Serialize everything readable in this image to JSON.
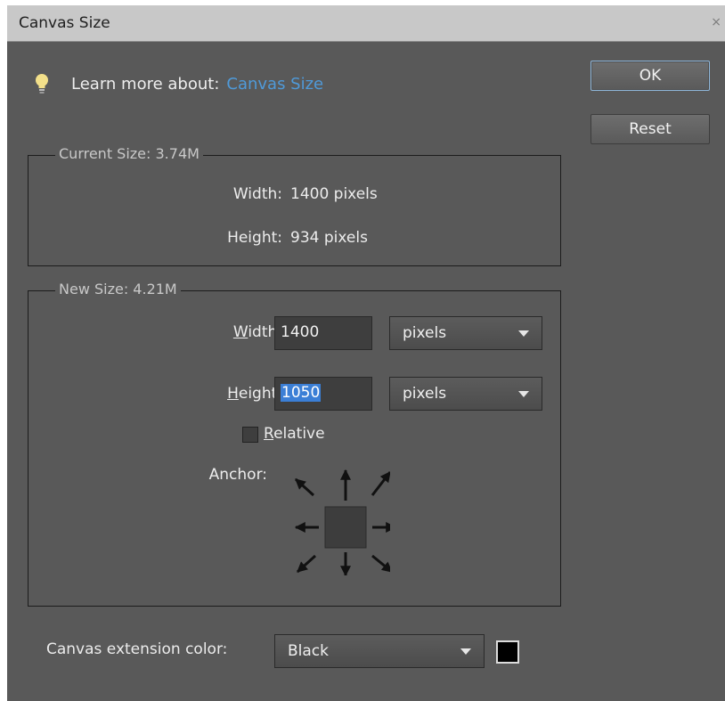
{
  "window": {
    "title": "Canvas Size",
    "close_glyph": "×"
  },
  "learn_more": {
    "prefix": "Learn more about:",
    "link": "Canvas Size",
    "icon": "lightbulb-icon"
  },
  "buttons": {
    "ok": "OK",
    "reset": "Reset"
  },
  "current_size": {
    "legend": "Current Size: 3.74M",
    "width_label": "Width:",
    "width_value": "1400 pixels",
    "height_label": "Height:",
    "height_value": "934 pixels"
  },
  "new_size": {
    "legend": "New Size: 4.21M",
    "width_label_u": "W",
    "width_label_rest": "idth:",
    "width_value": "1400",
    "width_unit": "pixels",
    "height_label_u": "H",
    "height_label_rest": "eight:",
    "height_value": "1050",
    "height_unit": "pixels",
    "relative_u": "R",
    "relative_rest": "elative",
    "relative_checked": false,
    "anchor_label": "Anchor:"
  },
  "extension": {
    "label": "Canvas extension color:",
    "value": "Black",
    "swatch_color": "#000000"
  },
  "colors": {
    "link": "#4f9ad9",
    "selection": "#3b7fd6",
    "dialog_bg": "#595959"
  }
}
